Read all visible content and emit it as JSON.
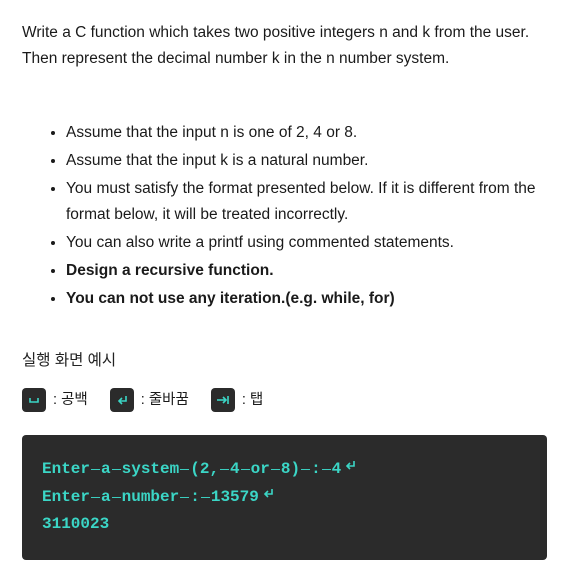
{
  "intro": "Write a C function which takes two positive integers n and k from the user. Then represent the decimal number k in the n number system.",
  "bullets": [
    {
      "text": "Assume that the input n is one of 2, 4 or 8.",
      "bold": false
    },
    {
      "text": "Assume that the input k is a natural number.",
      "bold": false
    },
    {
      "text": "You must satisfy the format presented below. If it is different from the format below, it will be treated incorrectly.",
      "bold": false
    },
    {
      "text": "You can also write a printf using commented statements.",
      "bold": false
    },
    {
      "text": "Design a recursive function.",
      "bold": true
    },
    {
      "text": "You can not use any iteration.(e.g. while, for)",
      "bold": true
    }
  ],
  "section_title": "실행 화면 예시",
  "legend": {
    "space": "공백",
    "newline": "줄바꿈",
    "tab": "탭"
  },
  "code": {
    "line1_tokens": [
      "Enter",
      "a",
      "system",
      "(2,",
      "4",
      "or",
      "8)",
      ":",
      "4"
    ],
    "line2_tokens": [
      "Enter",
      "a",
      "number",
      ":",
      "13579"
    ],
    "line3": "3110023"
  }
}
